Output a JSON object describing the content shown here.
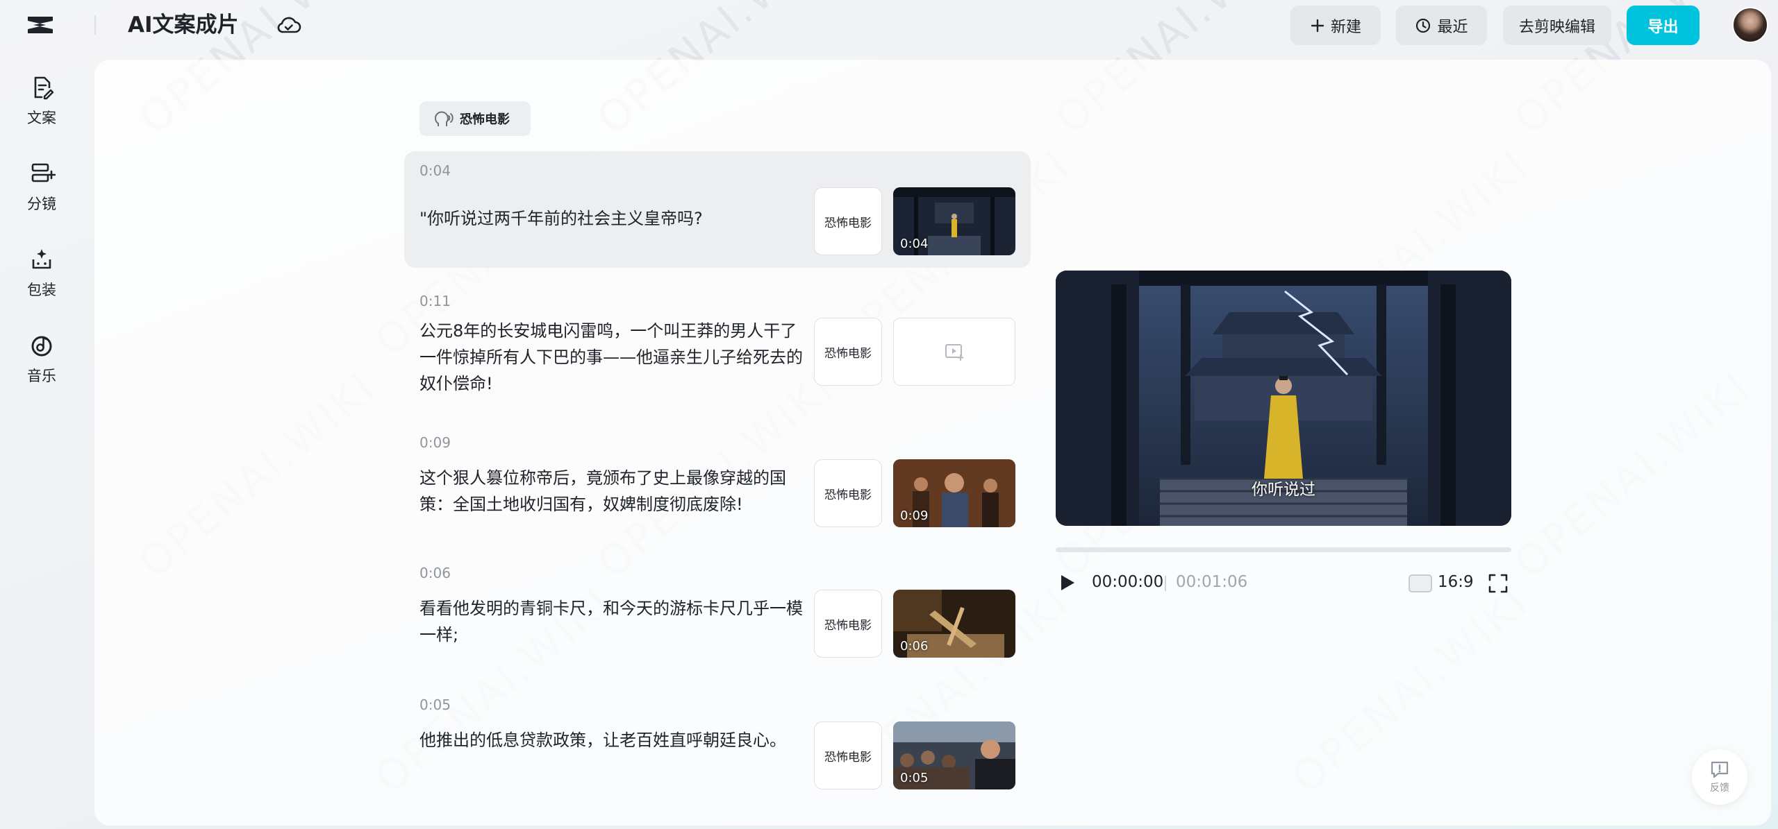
{
  "header": {
    "app_title": "AI文案成片",
    "buttons": {
      "new_label": "新建",
      "recent_label": "最近",
      "jianying_label": "去剪映编辑",
      "export_label": "导出"
    },
    "accent_color": "#00c4de"
  },
  "sidebar": {
    "items": [
      {
        "label": "文案",
        "icon": "document-edit-icon"
      },
      {
        "label": "分镜",
        "icon": "storyboard-icon"
      },
      {
        "label": "包装",
        "icon": "package-sparkle-icon"
      },
      {
        "label": "音乐",
        "icon": "music-disc-icon"
      }
    ]
  },
  "voice_tag": {
    "label": "恐怖电影",
    "icon": "voice-head-icon"
  },
  "segments": [
    {
      "time": "0:04",
      "text": "\"你听说过两千年前的社会主义皇帝吗?",
      "voice": "恐怖电影",
      "thumb_duration": "0:04",
      "has_thumb": true,
      "active": true
    },
    {
      "time": "0:11",
      "text": "公元8年的长安城电闪雷鸣，一个叫王莽的男人干了一件惊掉所有人下巴的事——他逼亲生儿子给死去的奴仆偿命!",
      "voice": "恐怖电影",
      "thumb_duration": "",
      "has_thumb": false,
      "active": false
    },
    {
      "time": "0:09",
      "text": "这个狠人篡位称帝后，竟颁布了史上最像穿越的国策：全国土地收归国有，奴婢制度彻底废除!",
      "voice": "恐怖电影",
      "thumb_duration": "0:09",
      "has_thumb": true,
      "active": false
    },
    {
      "time": "0:06",
      "text": "看看他发明的青铜卡尺，和今天的游标卡尺几乎一模一样;",
      "voice": "恐怖电影",
      "thumb_duration": "0:06",
      "has_thumb": true,
      "active": false
    },
    {
      "time": "0:05",
      "text": "他推出的低息贷款政策，让老百姓直呼朝廷良心。",
      "voice": "恐怖电影",
      "thumb_duration": "0:05",
      "has_thumb": true,
      "active": false
    }
  ],
  "preview": {
    "subtitle": "你听说过",
    "current_time": "00:00:00",
    "total_time": "00:01:06",
    "progress_fraction": 0.0,
    "aspect_ratio": "16:9"
  },
  "feedback": {
    "label": "反馈"
  },
  "watermark": "OPENAI.WIKI"
}
